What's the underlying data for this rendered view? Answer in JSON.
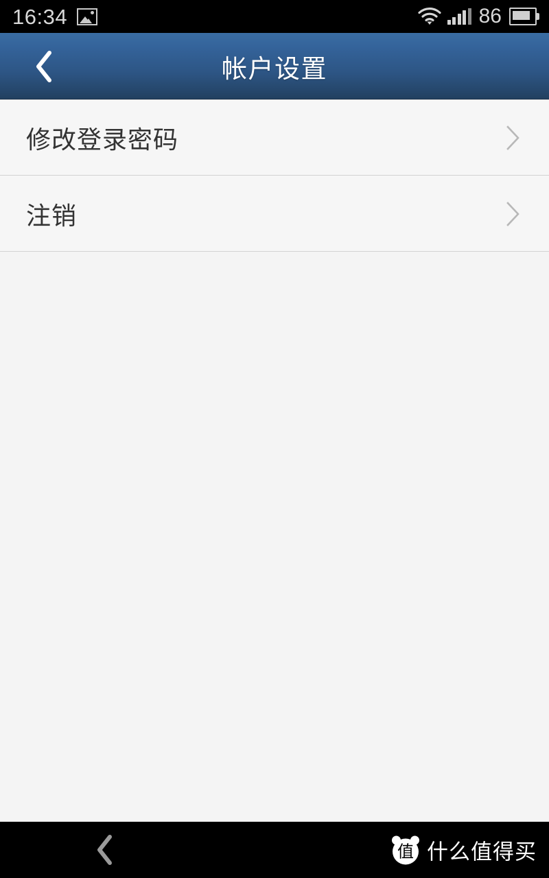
{
  "status_bar": {
    "time": "16:34",
    "notification_icon": "photo-icon",
    "wifi_icon": "wifi-icon",
    "signal_icon": "signal-bars-icon",
    "battery_percent": "86",
    "battery_icon": "battery-icon"
  },
  "header": {
    "title": "帐户设置",
    "back_icon": "chevron-left-icon",
    "gradient_top": "#3a6da3",
    "gradient_bottom": "#22405f"
  },
  "list": {
    "items": [
      {
        "label": "修改登录密码",
        "chevron": "chevron-right-icon"
      },
      {
        "label": "注销",
        "chevron": "chevron-right-icon"
      }
    ]
  },
  "nav_bar": {
    "back_icon": "chevron-left-icon",
    "watermark_mark": "值",
    "watermark_text": "什么值得买"
  },
  "colors": {
    "page_background": "#f4f4f4",
    "row_background": "#f6f6f6",
    "row_text": "#333333",
    "divider": "#d2d2d2",
    "chevron": "#b8b8b8",
    "status_bar_bg": "#000000"
  }
}
